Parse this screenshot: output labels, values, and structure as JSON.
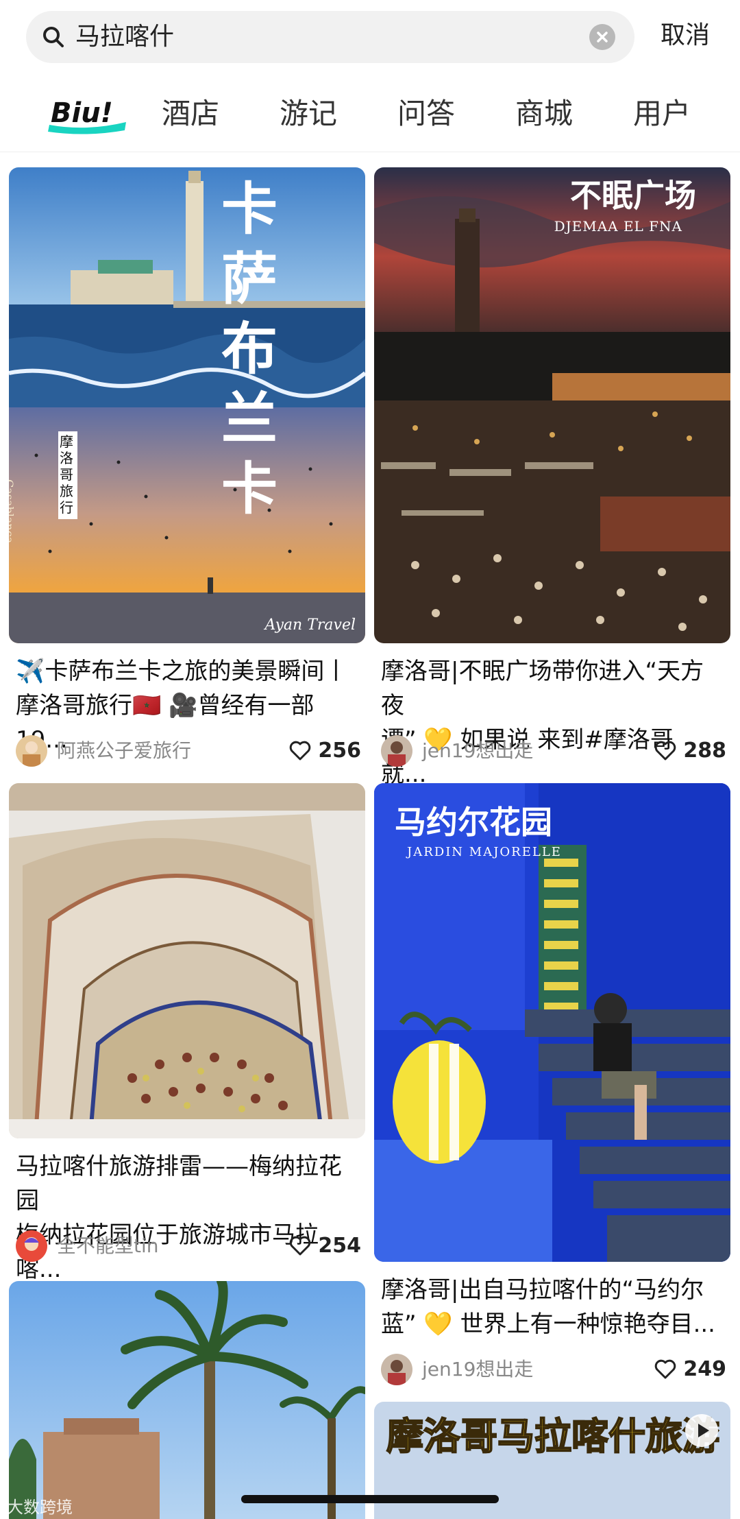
{
  "search": {
    "query": "马拉喀什",
    "cancel_label": "取消"
  },
  "tabs": {
    "logo_text": "Biu!",
    "items": [
      "酒店",
      "游记",
      "问答",
      "商城",
      "用户"
    ]
  },
  "feed": [
    {
      "image_text_main": "卡萨布兰卡",
      "image_text_side": "摩洛哥旅行",
      "image_text_side_en": "Casablanca",
      "image_text_brand": "Ayan Travel",
      "title_line1": "✈️卡萨布兰卡之旅的美景瞬间丨",
      "title_line2": "摩洛哥旅行🇲🇦 🎥曾经有一部19...",
      "author": "阿燕公子爱旅行",
      "likes": "256"
    },
    {
      "image_text_main": "不眠广场",
      "image_text_sub": "DJEMAA EL FNA",
      "title_line1": "摩洛哥|不眠广场带你进入“天方夜",
      "title_line2": "谭” 💛 如果说 来到#摩洛哥 就...",
      "author": "jen19想出走",
      "likes": "288"
    },
    {
      "title_line1": "马拉喀什旅游排雷——梅纳拉花园",
      "title_line2": "梅纳拉花园位于旅游城市马拉喀...",
      "author": "全不能型tin",
      "likes": "254"
    },
    {
      "image_text_main": "马约尔花园",
      "image_text_sub": "JARDIN MAJORELLE",
      "title_line1": "摩洛哥|出自马拉喀什的“马约尔",
      "title_line2": "蓝” 💛 世界上有一种惊艳夺目...",
      "author": "jen19想出走",
      "likes": "249"
    },
    {
      "image_text_main": "摩洛哥马拉喀什旅游"
    }
  ],
  "watermark": "大数跨境",
  "colors": {
    "accent_teal": "#19d4c1",
    "majorelle_blue": "#1d3fd1",
    "title_yellow": "#ffd81a"
  }
}
